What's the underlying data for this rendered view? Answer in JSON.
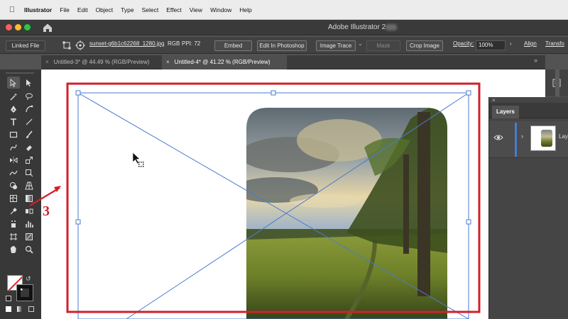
{
  "menubar": {
    "apple": "",
    "items": [
      "Illustrator",
      "File",
      "Edit",
      "Object",
      "Type",
      "Select",
      "Effect",
      "View",
      "Window",
      "Help"
    ]
  },
  "title": {
    "app_title": "Adobe Illustrator 2"
  },
  "control_bar": {
    "linked_file": "Linked File",
    "file_name": "sunset-g6b1c62268_1280.jpg",
    "color_mode": "RGB",
    "ppi": "PPI: 72",
    "embed": "Embed",
    "edit_in_photoshop": "Edit In Photoshop",
    "image_trace": "Image Trace",
    "mask": "Mask",
    "crop_image": "Crop Image",
    "opacity_label": "Opacity:",
    "opacity_value": "100%",
    "align": "Align",
    "transform": "Transfo"
  },
  "tabs": [
    {
      "label": "Untitled-3* @ 44.49 % (RGB/Preview)",
      "active": false
    },
    {
      "label": "Untitled-4* @ 41.22 % (RGB/Preview)",
      "active": true
    }
  ],
  "annotation": {
    "number": "3",
    "color": "#d0202a"
  },
  "layers_panel": {
    "title": "Layers",
    "layer_name": "Lay"
  },
  "colors": {
    "accent_red": "#d0202a",
    "selection_blue": "#4a7bd0"
  }
}
